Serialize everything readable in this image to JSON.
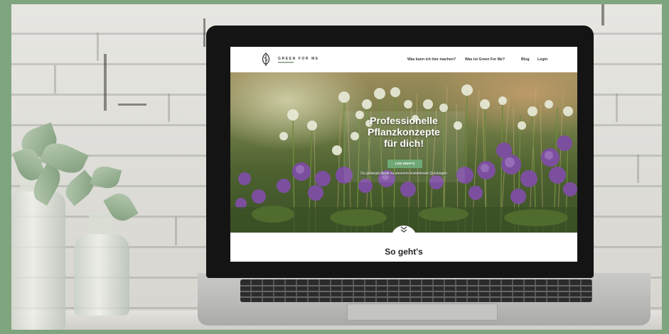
{
  "site": {
    "brand": "GREEN FOR ME",
    "nav": [
      {
        "label": "Was kann ich hier machen?"
      },
      {
        "label": "Was ist Green For Me?"
      },
      {
        "label": "Blog"
      },
      {
        "label": "Login"
      }
    ],
    "hero": {
      "title_line1": "Professionelle",
      "title_line2": "Pflanzkonzepte",
      "title_line3": "für dich!",
      "cta_label": "LOS GEHT'S",
      "subtext": "Du gelangst direkt zu unserem kostenlosen Quizbogen"
    },
    "section_title": "So geht's"
  },
  "colors": {
    "border": "#7fa57f",
    "accent": "#6fa775",
    "bezel": "#141414"
  },
  "icons": {
    "logo": "leaf-icon",
    "scroll": "chevron-down-icon"
  }
}
